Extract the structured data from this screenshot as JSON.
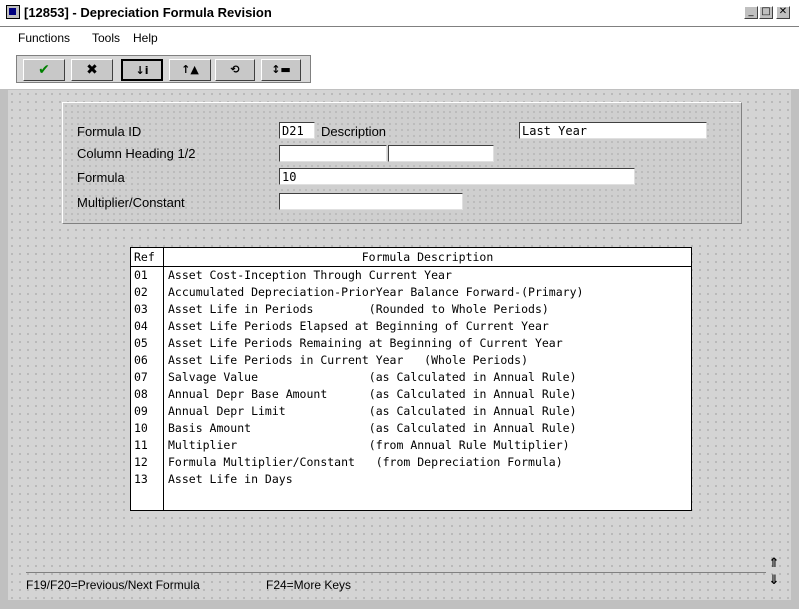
{
  "window": {
    "title": "[12853] - Depreciation Formula Revision",
    "controls": [
      "_",
      "□",
      "✕"
    ]
  },
  "menu": {
    "items": [
      "Functions",
      "Tools",
      "Help"
    ]
  },
  "toolbar": {
    "buttons": [
      {
        "name": "ok-button",
        "glyph": "✔"
      },
      {
        "name": "cancel-button",
        "glyph": "✖"
      },
      {
        "name": "inquire-button",
        "glyph": "↓i"
      },
      {
        "name": "add-button",
        "glyph": "↑▲"
      },
      {
        "name": "change-button",
        "glyph": "⟲"
      },
      {
        "name": "delete-button",
        "glyph": "↕▬"
      }
    ]
  },
  "form": {
    "formula_id_label": "Formula ID",
    "formula_id_value": "D21",
    "description_label": "Description",
    "description_value": "Last Year",
    "column_heading_label": "Column Heading 1/2",
    "column_heading_1_value": "",
    "column_heading_2_value": "",
    "formula_label": "Formula",
    "formula_value": "10",
    "multiplier_label": "Multiplier/Constant",
    "multiplier_value": ""
  },
  "listbox": {
    "header_ref": "Ref",
    "header_desc": "Formula Description",
    "rows": [
      {
        "ref": "01",
        "desc": "Asset Cost-Inception Through Current Year"
      },
      {
        "ref": "02",
        "desc": "Accumulated Depreciation-PriorYear Balance Forward-(Primary)"
      },
      {
        "ref": "03",
        "desc": "Asset Life in Periods        (Rounded to Whole Periods)"
      },
      {
        "ref": "04",
        "desc": "Asset Life Periods Elapsed at Beginning of Current Year"
      },
      {
        "ref": "05",
        "desc": "Asset Life Periods Remaining at Beginning of Current Year"
      },
      {
        "ref": "06",
        "desc": "Asset Life Periods in Current Year   (Whole Periods)"
      },
      {
        "ref": "07",
        "desc": "Salvage Value                (as Calculated in Annual Rule)"
      },
      {
        "ref": "08",
        "desc": "Annual Depr Base Amount      (as Calculated in Annual Rule)"
      },
      {
        "ref": "09",
        "desc": "Annual Depr Limit            (as Calculated in Annual Rule)"
      },
      {
        "ref": "10",
        "desc": "Basis Amount                 (as Calculated in Annual Rule)"
      },
      {
        "ref": "11",
        "desc": "Multiplier                   (from Annual Rule Multiplier)"
      },
      {
        "ref": "12",
        "desc": "Formula Multiplier/Constant   (from Depreciation Formula)"
      },
      {
        "ref": "13",
        "desc": "Asset Life in Days"
      }
    ]
  },
  "status": {
    "left": "F19/F20=Previous/Next Formula",
    "right": "F24=More Keys"
  },
  "nav": {
    "up": "⇑",
    "down": "⇓"
  }
}
